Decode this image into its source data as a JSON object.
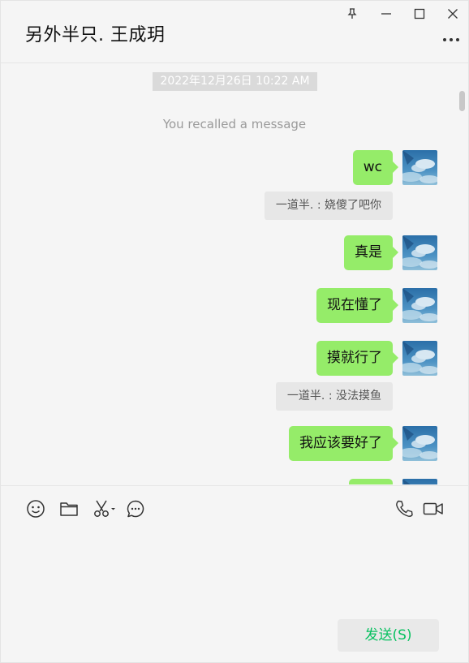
{
  "header": {
    "title": "另外半只. 王成玥"
  },
  "messages": {
    "timestamp": "2022年12月26日 10:22 AM",
    "recalled": "You recalled a message",
    "items": [
      {
        "type": "sent",
        "text": "wc"
      },
      {
        "type": "quote",
        "text": "一道半. : 娆傻了吧你"
      },
      {
        "type": "sent",
        "text": "真是"
      },
      {
        "type": "sent",
        "text": "现在懂了"
      },
      {
        "type": "sent",
        "text": "摸就行了"
      },
      {
        "type": "quote",
        "text": "一道半. : 没法摸鱼"
      },
      {
        "type": "sent",
        "text": "我应该要好了"
      },
      {
        "type": "sent",
        "text": ""
      }
    ]
  },
  "toolbar": {
    "left_icons": [
      "emoji-icon",
      "folder-icon",
      "scissors-icon",
      "chat-history-icon"
    ],
    "right_icons": [
      "phone-icon",
      "video-icon"
    ]
  },
  "send_button": {
    "label": "发送(S)"
  },
  "colors": {
    "bubble": "#95ec69",
    "accent": "#07c160",
    "background": "#f5f5f5"
  }
}
